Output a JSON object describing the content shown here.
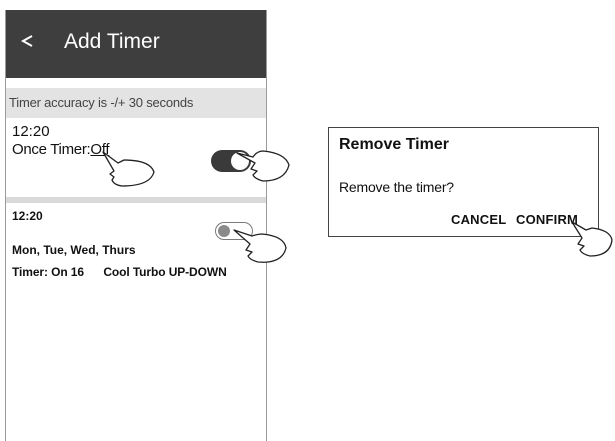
{
  "header": {
    "title": "Add Timer",
    "back_icon": "back-arrow-icon"
  },
  "notice": "Timer accuracy is -/+ 30 seconds",
  "timer1": {
    "time": "12:20",
    "mode_label": "Once Timer:",
    "mode_value": "Off",
    "enabled": true
  },
  "timer2": {
    "time": "12:20",
    "days": "Mon, Tue, Wed, Thurs",
    "timer_label": "Timer: On 16",
    "mode": "Cool",
    "fan": "Turbo",
    "swing": "UP-DOWN",
    "enabled": false
  },
  "dialog": {
    "title": "Remove Timer",
    "message": "Remove the timer?",
    "cancel_label": "CANCEL",
    "confirm_label": "CONFIRM"
  },
  "colors": {
    "appbar": "#3e3e3e",
    "notice_bg": "#e3e3e3",
    "toggle_on": "#3a3a3a",
    "separator": "#dadada"
  },
  "icons": [
    "back-arrow-icon",
    "pointing-hand-icon"
  ]
}
